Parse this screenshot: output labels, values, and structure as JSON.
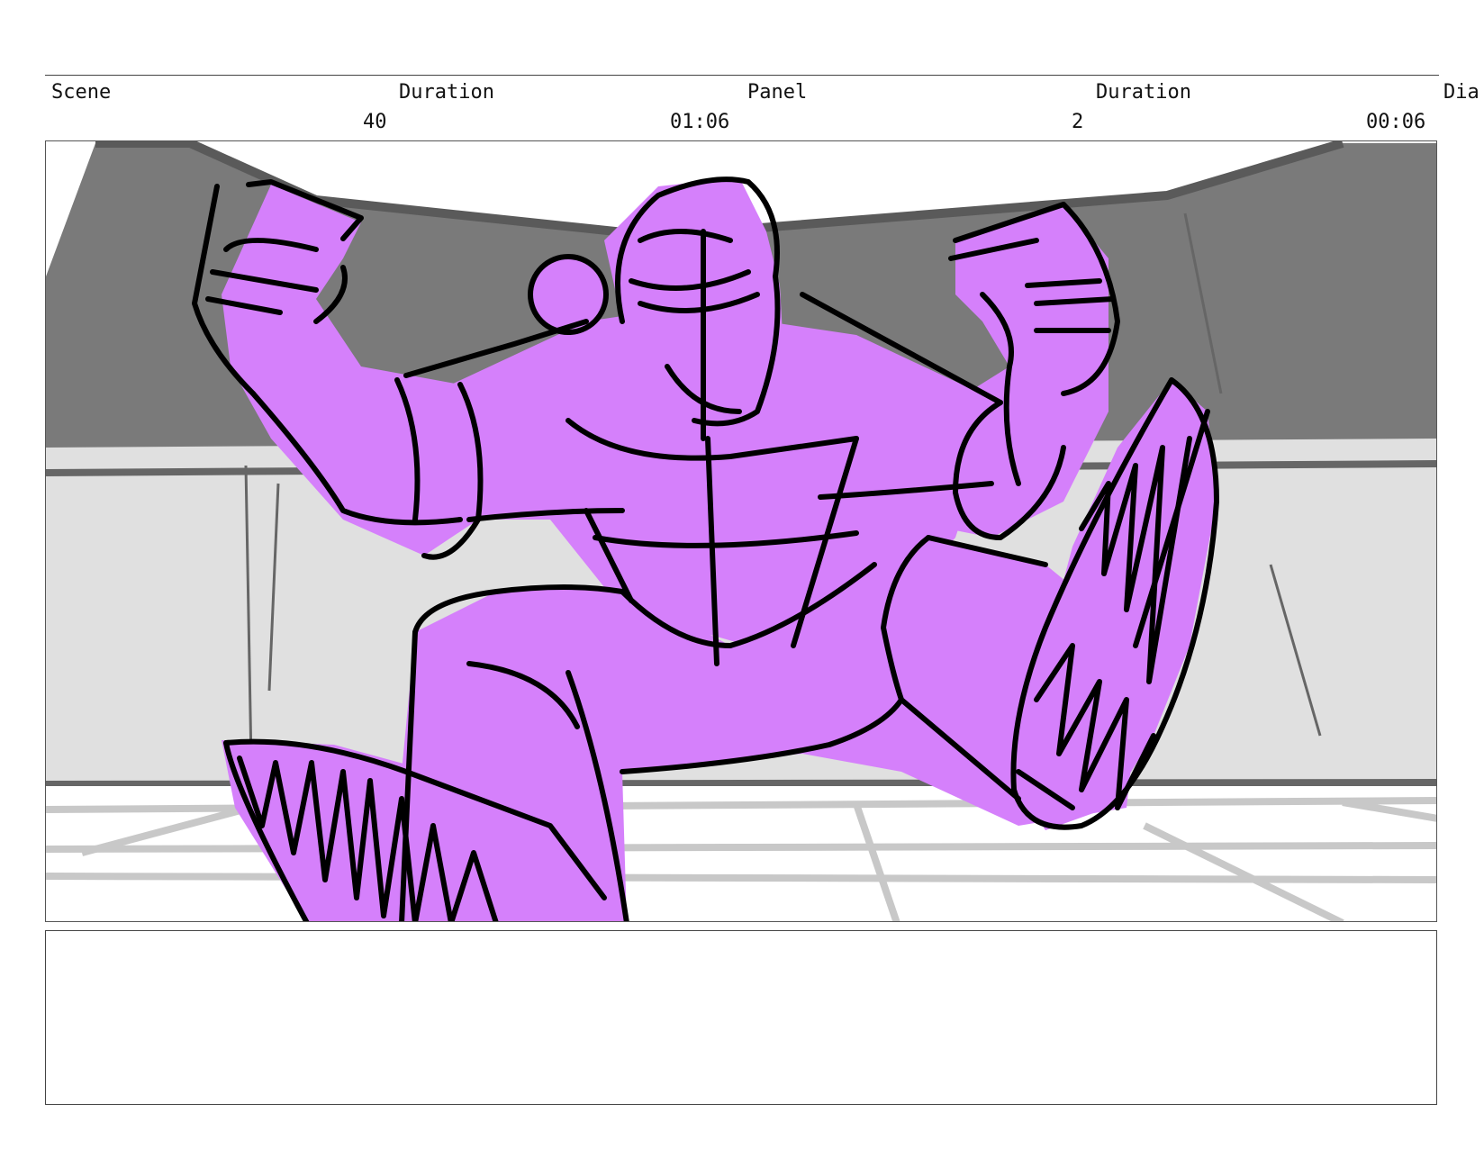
{
  "header": {
    "scene_label": "Scene",
    "scene_duration_label": "Duration",
    "panel_label": "Panel",
    "panel_duration_label": "Duration",
    "dialogue_label": "Dia",
    "scene_value": "40",
    "scene_duration_value": "01:06",
    "panel_value": "2",
    "panel_duration_value": "00:06"
  },
  "artwork": {
    "figure_fill": "#d580fb",
    "wall_upper": "#7a7a7a",
    "wall_lower": "#e0e0e0",
    "floor": "#ffffff",
    "floor_lines": "#c8c8c8",
    "ink": "#000000"
  },
  "notes": {
    "text": ""
  }
}
